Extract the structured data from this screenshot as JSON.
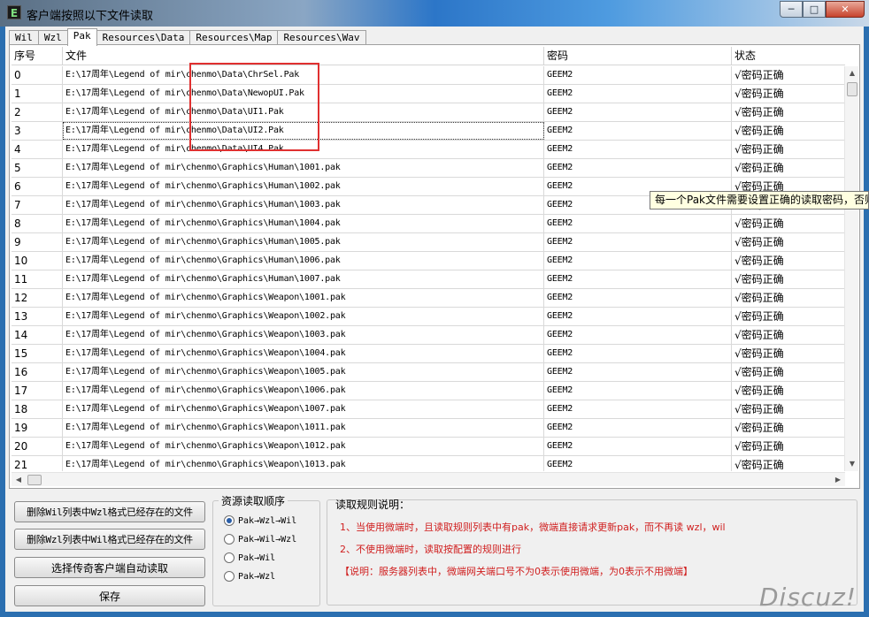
{
  "window": {
    "icon_letter": "E",
    "title": "客户端按照以下文件读取",
    "min_glyph": "─",
    "max_glyph": "□",
    "close_glyph": "✕"
  },
  "tabs": [
    {
      "label": "Wil"
    },
    {
      "label": "Wzl"
    },
    {
      "label": "Pak",
      "active": true
    },
    {
      "label": "Resources\\Data"
    },
    {
      "label": "Resources\\Map"
    },
    {
      "label": "Resources\\Wav"
    }
  ],
  "grid": {
    "headers": [
      "序号",
      "文件",
      "密码",
      "状态"
    ],
    "rows": [
      [
        "0",
        "E:\\17周年\\Legend of mir\\chenmo\\Data\\ChrSel.Pak",
        "GEEM2",
        "√密码正确"
      ],
      [
        "1",
        "E:\\17周年\\Legend of mir\\chenmo\\Data\\NewopUI.Pak",
        "GEEM2",
        "√密码正确"
      ],
      [
        "2",
        "E:\\17周年\\Legend of mir\\chenmo\\Data\\UI1.Pak",
        "GEEM2",
        "√密码正确"
      ],
      [
        "3",
        "E:\\17周年\\Legend of mir\\chenmo\\Data\\UI2.Pak",
        "GEEM2",
        "√密码正确"
      ],
      [
        "4",
        "E:\\17周年\\Legend of mir\\chenmo\\Data\\UI4.Pak",
        "GEEM2",
        "√密码正确"
      ],
      [
        "5",
        "E:\\17周年\\Legend of mir\\chenmo\\Graphics\\Human\\1001.pak",
        "GEEM2",
        "√密码正确"
      ],
      [
        "6",
        "E:\\17周年\\Legend of mir\\chenmo\\Graphics\\Human\\1002.pak",
        "GEEM2",
        "√密码正确"
      ],
      [
        "7",
        "E:\\17周年\\Legend of mir\\chenmo\\Graphics\\Human\\1003.pak",
        "GEEM2",
        "√密码正确"
      ],
      [
        "8",
        "E:\\17周年\\Legend of mir\\chenmo\\Graphics\\Human\\1004.pak",
        "GEEM2",
        "√密码正确"
      ],
      [
        "9",
        "E:\\17周年\\Legend of mir\\chenmo\\Graphics\\Human\\1005.pak",
        "GEEM2",
        "√密码正确"
      ],
      [
        "10",
        "E:\\17周年\\Legend of mir\\chenmo\\Graphics\\Human\\1006.pak",
        "GEEM2",
        "√密码正确"
      ],
      [
        "11",
        "E:\\17周年\\Legend of mir\\chenmo\\Graphics\\Human\\1007.pak",
        "GEEM2",
        "√密码正确"
      ],
      [
        "12",
        "E:\\17周年\\Legend of mir\\chenmo\\Graphics\\Weapon\\1001.pak",
        "GEEM2",
        "√密码正确"
      ],
      [
        "13",
        "E:\\17周年\\Legend of mir\\chenmo\\Graphics\\Weapon\\1002.pak",
        "GEEM2",
        "√密码正确"
      ],
      [
        "14",
        "E:\\17周年\\Legend of mir\\chenmo\\Graphics\\Weapon\\1003.pak",
        "GEEM2",
        "√密码正确"
      ],
      [
        "15",
        "E:\\17周年\\Legend of mir\\chenmo\\Graphics\\Weapon\\1004.pak",
        "GEEM2",
        "√密码正确"
      ],
      [
        "16",
        "E:\\17周年\\Legend of mir\\chenmo\\Graphics\\Weapon\\1005.pak",
        "GEEM2",
        "√密码正确"
      ],
      [
        "17",
        "E:\\17周年\\Legend of mir\\chenmo\\Graphics\\Weapon\\1006.pak",
        "GEEM2",
        "√密码正确"
      ],
      [
        "18",
        "E:\\17周年\\Legend of mir\\chenmo\\Graphics\\Weapon\\1007.pak",
        "GEEM2",
        "√密码正确"
      ],
      [
        "19",
        "E:\\17周年\\Legend of mir\\chenmo\\Graphics\\Weapon\\1011.pak",
        "GEEM2",
        "√密码正确"
      ],
      [
        "20",
        "E:\\17周年\\Legend of mir\\chenmo\\Graphics\\Weapon\\1012.pak",
        "GEEM2",
        "√密码正确"
      ],
      [
        "21",
        "E:\\17周年\\Legend of mir\\chenmo\\Graphics\\Weapon\\1013.pak",
        "GEEM2",
        "√密码正确"
      ]
    ],
    "tooltip": "每一个Pak文件需要设置正确的读取密码，否则"
  },
  "buttons": {
    "delete_wil": "删除Wil列表中Wzl格式已经存在的文件",
    "delete_wzl": "删除Wzl列表中Wil格式已经存在的文件",
    "select_client": "选择传奇客户端自动读取",
    "save": "保存"
  },
  "order_group": {
    "title": "资源读取顺序",
    "options": [
      {
        "label": "Pak→Wzl→Wil",
        "selected": true
      },
      {
        "label": "Pak→Wil→Wzl",
        "selected": false
      },
      {
        "label": "Pak→Wil",
        "selected": false
      },
      {
        "label": "Pak→Wzl",
        "selected": false
      }
    ]
  },
  "rules": {
    "title": "读取规则说明：",
    "line1": "1、当使用微端时，且读取规则列表中有pak，微端直接请求更新pak，而不再读 wzl，wil",
    "line2": "2、不使用微端时，读取按配置的规则进行",
    "line3": "【说明：服务器列表中，微端网关端口号不为0表示使用微端，为0表示不用微端】",
    "color": "#d02020"
  },
  "watermark": "Discuz!"
}
